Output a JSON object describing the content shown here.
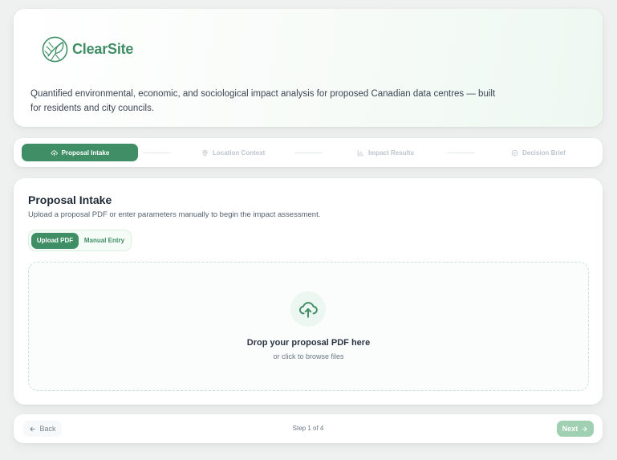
{
  "brand": {
    "name": "ClearSite",
    "tagline": "Quantified environmental, economic, and sociological impact analysis for proposed Canadian data centres — built for residents and city councils.",
    "accent": "#3f8e65"
  },
  "stepper": {
    "steps": [
      {
        "label": "Proposal Intake",
        "icon": "upload-cloud-icon",
        "active": true
      },
      {
        "label": "Location Context",
        "icon": "map-pin-icon",
        "active": false
      },
      {
        "label": "Impact Results",
        "icon": "bar-chart-icon",
        "active": false
      },
      {
        "label": "Decision Brief",
        "icon": "check-circle-icon",
        "active": false
      }
    ]
  },
  "main": {
    "title": "Proposal Intake",
    "subtitle": "Upload a proposal PDF or enter parameters manually to begin the impact assessment.",
    "tabs": [
      {
        "label": "Upload PDF",
        "selected": true
      },
      {
        "label": "Manual Entry",
        "selected": false
      }
    ],
    "dropzone": {
      "icon": "upload-cloud-icon",
      "title": "Drop your proposal PDF here",
      "subtitle": "or click to browse files"
    }
  },
  "footer": {
    "back_label": "Back",
    "step_text": "Step 1 of 4",
    "next_label": "Next"
  }
}
